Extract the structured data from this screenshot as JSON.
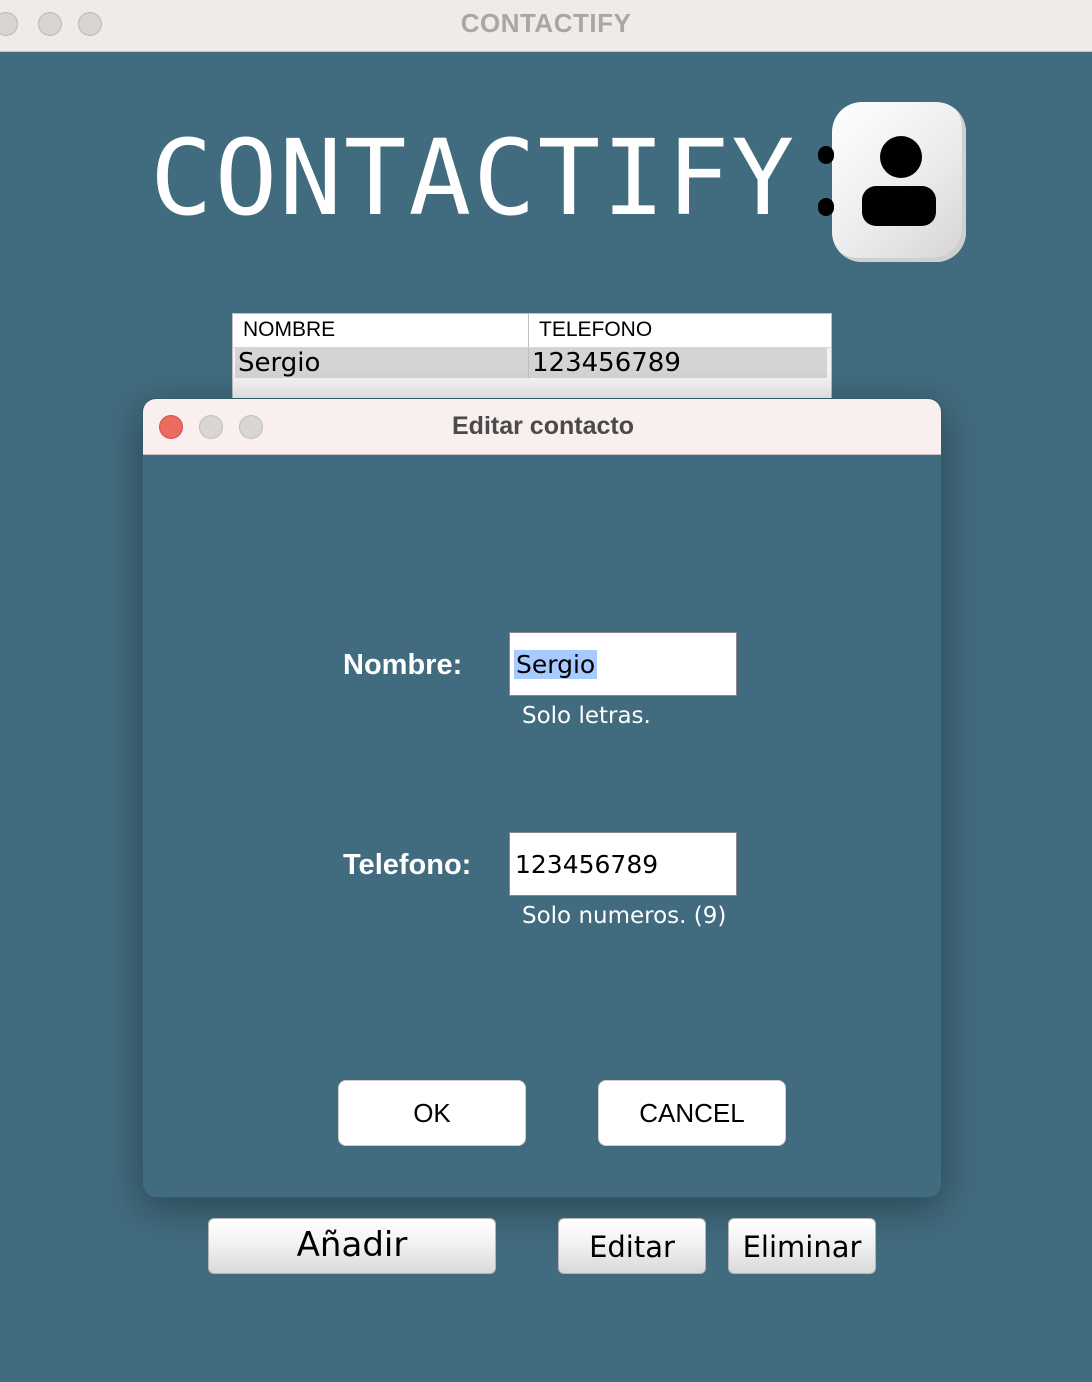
{
  "window": {
    "title": "CONTACTIFY"
  },
  "app": {
    "heading": "CONTACTIFY",
    "logo_icon": "contact-book-icon"
  },
  "table": {
    "columns": [
      "NOMBRE",
      "TELEFONO"
    ],
    "rows": [
      {
        "nombre": "Sergio",
        "telefono": "123456789",
        "selected": true
      }
    ]
  },
  "dialog": {
    "title": "Editar contacto",
    "nombre": {
      "label": "Nombre:",
      "value": "Sergio",
      "hint": "Solo letras."
    },
    "telefono": {
      "label": "Telefono:",
      "value": "123456789",
      "hint": "Solo numeros. (9)"
    },
    "ok_label": "OK",
    "cancel_label": "CANCEL"
  },
  "buttons": {
    "add": "Añadir",
    "edit": "Editar",
    "delete": "Eliminar"
  },
  "colors": {
    "background": "#416b7e",
    "selection": "#a8cbff",
    "close_red": "#ec6a5e"
  }
}
